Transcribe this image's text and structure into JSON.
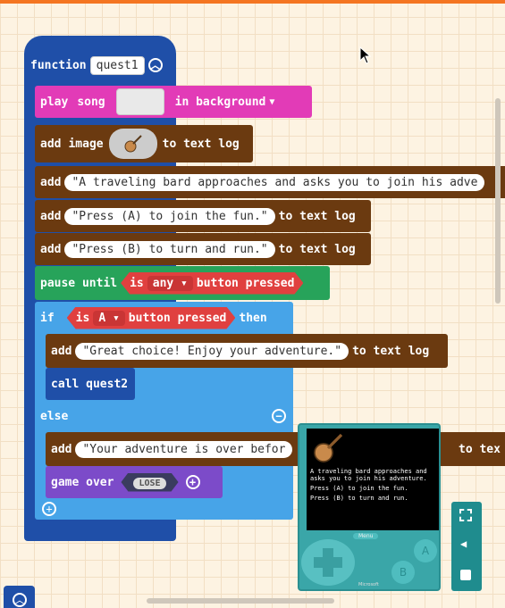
{
  "blocks": {
    "function_keyword": "function",
    "function_name": "quest1",
    "play": "play",
    "song": "song",
    "in_background": "in background",
    "add1": "add",
    "image": "image",
    "to_text_log": "to text log",
    "add2": "add",
    "text_bard": "\"A traveling bard approaches and asks you to join his adve",
    "add3": "add",
    "text_press_a": "\"Press (A) to join the fun.\"",
    "to_text_log3": "to text log",
    "add4": "add",
    "text_press_b": "\"Press (B) to turn and run.\"",
    "to_text_log4": "to text log",
    "pause_until": "pause until",
    "is": "is",
    "any": "any",
    "button_pressed": "button pressed",
    "if": "if",
    "is2": "is",
    "a": "A",
    "button_pressed2": "button pressed",
    "then": "then",
    "add5": "add",
    "text_great": "\"Great choice! Enjoy your adventure.\"",
    "to_text_log5": "to text log",
    "call": "call quest2",
    "else": "else",
    "add6": "add",
    "text_over": "\"Your adventure is over befor",
    "to_text_log6": "to tex",
    "game_over": "game over",
    "lose": "LOSE"
  },
  "simulator": {
    "screen_text1": "A traveling bard approaches and asks you to join his adventure.",
    "screen_text2": "Press (A) to join the fun.",
    "screen_text3": "Press (B) to turn and run.",
    "menu": "Menu",
    "btn_a": "A",
    "btn_b": "B",
    "brand": "Microsoft"
  },
  "colors": {
    "function": "#1f4fa8",
    "brown": "#6b3a10",
    "pink": "#e23bb7",
    "green": "#27a35a",
    "blue": "#47a4e8",
    "navy": "#1f4fa8",
    "purple": "#7c4bc9",
    "teal": "#3aa6a8"
  },
  "icons": [
    "expand-icon",
    "volume-icon",
    "stop-icon",
    "collapse-icon",
    "add-icon",
    "remove-icon",
    "banjo-icon",
    "cursor-icon"
  ]
}
